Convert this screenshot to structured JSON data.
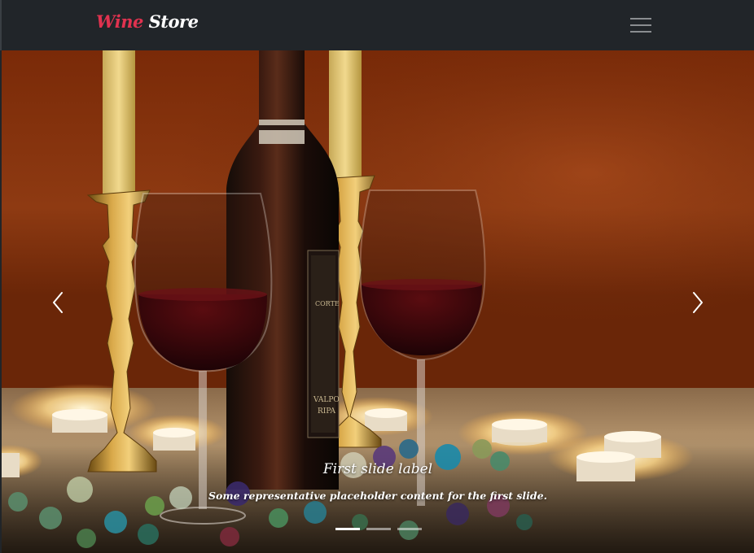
{
  "navbar": {
    "brand_part1": "Wine",
    "brand_part2": "Store",
    "brand_accent_color": "#e0324f",
    "toggle_icon": "hamburger-icon"
  },
  "carousel": {
    "prev_icon": "chevron-left-icon",
    "next_icon": "chevron-right-icon",
    "active_slide": 1,
    "slide_count": 3,
    "caption": {
      "title": "First slide label",
      "text": "Some representative placeholder content for the first slide."
    }
  }
}
